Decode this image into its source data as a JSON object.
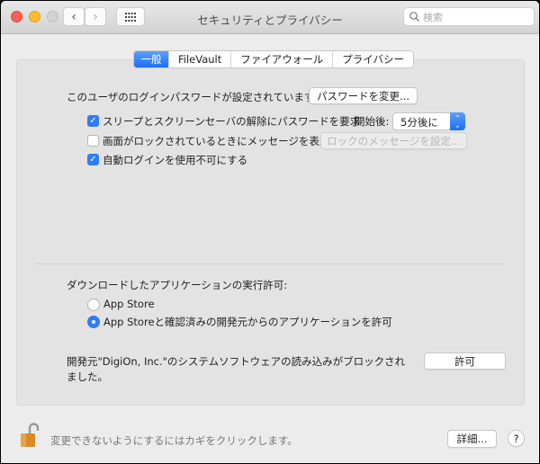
{
  "window": {
    "title": "セキュリティとプライバシー",
    "search_placeholder": "検索"
  },
  "tabs": [
    {
      "label": "一般",
      "active": true
    },
    {
      "label": "FileVault"
    },
    {
      "label": "ファイアウォール"
    },
    {
      "label": "プライバシー"
    }
  ],
  "general": {
    "password_text": "このユーザのログインパスワードが設定されています",
    "change_password_button": "パスワードを変更...",
    "require_password_label": "スリープとスクリーンセーバの解除にパスワードを要求",
    "require_password_checked": true,
    "start_after_label": "開始後:",
    "start_after_value": "5分後に",
    "show_message_label": "画面がロックされているときにメッセージを表示",
    "show_message_checked": false,
    "set_lock_message_button": "ロックのメッセージを設定...",
    "disable_auto_login_label": "自動ログインを使用不可にする",
    "disable_auto_login_checked": true
  },
  "downloads": {
    "label": "ダウンロードしたアプリケーションの実行許可:",
    "options": [
      {
        "label": "App Store",
        "selected": false
      },
      {
        "label": "App Storeと確認済みの開発元からのアプリケーションを許可",
        "selected": true
      }
    ]
  },
  "blocked": {
    "line1": "開発元\"DigiOn, Inc.\"のシステムソフトウェアの読み込みがブロックされ",
    "line2": "ました。",
    "allow_button": "許可"
  },
  "footer": {
    "lock_text": "変更できないようにするにはカギをクリックします。",
    "advanced_button": "詳細...",
    "help_button": "?"
  },
  "colors": {
    "accent": "#2f7cf6"
  }
}
